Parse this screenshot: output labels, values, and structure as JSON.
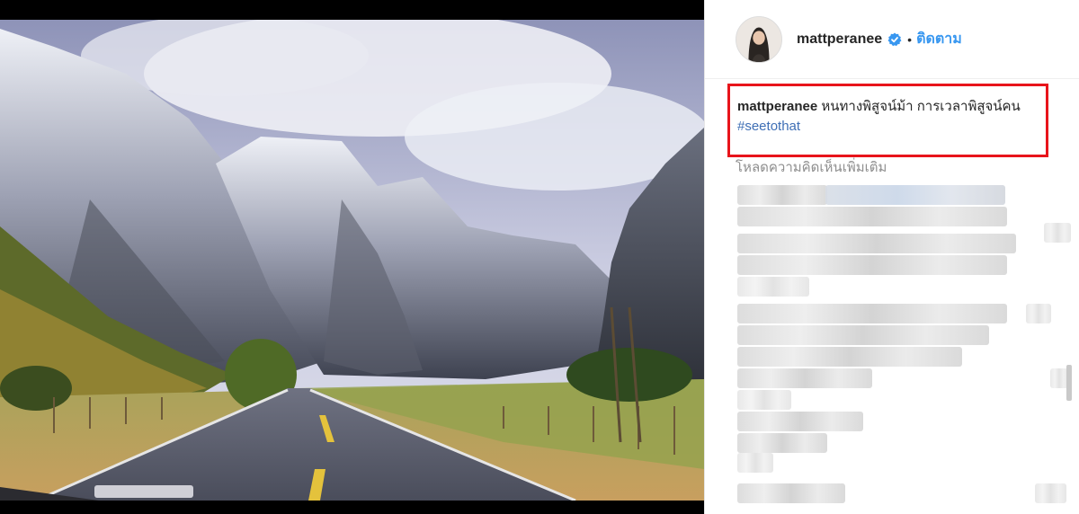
{
  "post": {
    "username": "mattperanee",
    "follow_label": "ติดตาม",
    "separator": "•",
    "caption_user": "mattperanee",
    "caption_text": "หนทางพิสูจน์ม้า การเวลาพิสูจน์คน",
    "hashtag": "#seetothat",
    "load_more": "โหลดความคิดเห็นเพิ่มเติม"
  },
  "colors": {
    "accent": "#3897f0",
    "highlight_border": "#e8141b",
    "hashtag": "#3f6fb5"
  },
  "icons": {
    "verified": "verified-badge-icon"
  }
}
